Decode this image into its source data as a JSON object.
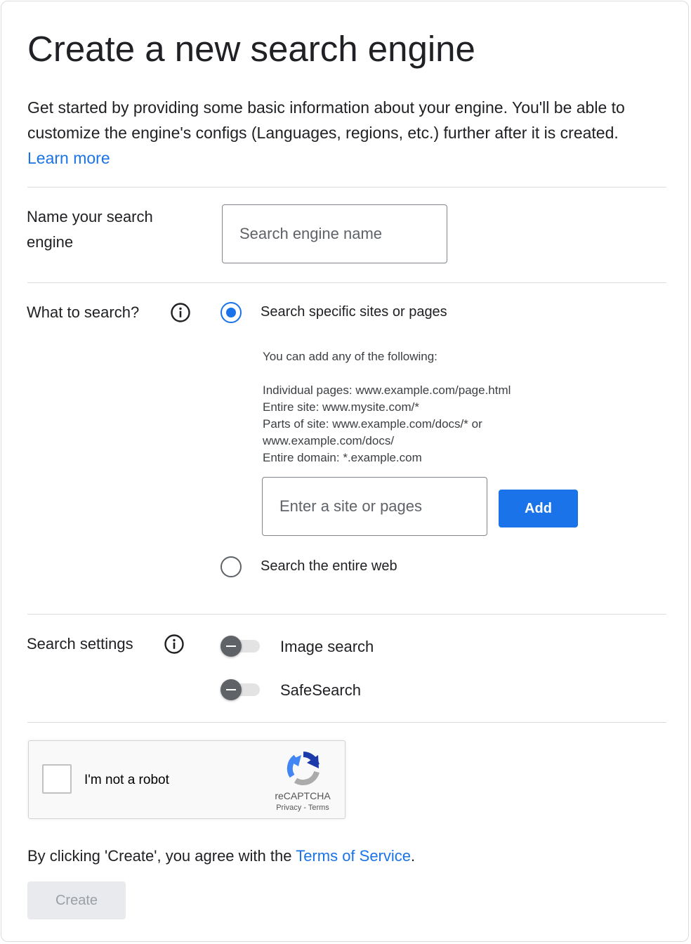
{
  "page": {
    "title": "Create a new search engine",
    "intro": "Get started by providing some basic information about your engine. You'll be able to customize the engine's configs (Languages, regions, etc.) further after it is created.",
    "learn_more": "Learn more"
  },
  "name_section": {
    "label": "Name your search engine",
    "placeholder": "Search engine name",
    "value": ""
  },
  "what_section": {
    "label": "What to search?",
    "info_icon": "info-icon",
    "option_specific": {
      "label": "Search specific sites or pages",
      "selected": true
    },
    "help_lines": [
      "You can add any of the following:",
      "",
      "Individual pages: www.example.com/page.html",
      "Entire site: www.mysite.com/*",
      "Parts of site: www.example.com/docs/* or",
      "www.example.com/docs/",
      "Entire domain: *.example.com"
    ],
    "site_placeholder": "Enter a site or pages",
    "site_value": "",
    "add_label": "Add",
    "option_entire_web": {
      "label": "Search the entire web",
      "selected": false
    }
  },
  "settings_section": {
    "label": "Search settings",
    "info_icon": "info-icon",
    "image_search": {
      "label": "Image search",
      "enabled": false
    },
    "safe_search": {
      "label": "SafeSearch",
      "enabled": false
    }
  },
  "captcha": {
    "label": "I'm not a robot",
    "brand": "reCAPTCHA",
    "privacy": "Privacy",
    "separator": " - ",
    "terms": "Terms",
    "checked": false
  },
  "footer": {
    "agree_prefix": "By clicking 'Create', you agree with the ",
    "terms_link": "Terms of Service",
    "agree_suffix": ".",
    "create_label": "Create"
  },
  "colors": {
    "accent": "#1a73e8",
    "text": "#202124",
    "disabled_button": "#e8eaed",
    "divider": "#dadce0"
  }
}
